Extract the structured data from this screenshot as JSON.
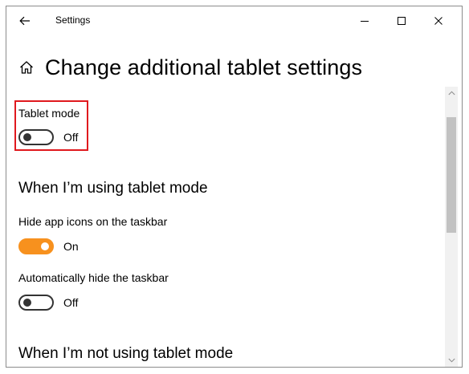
{
  "window": {
    "title": "Settings"
  },
  "page": {
    "title": "Change additional tablet settings"
  },
  "tablet_mode": {
    "label": "Tablet mode",
    "state_label": "Off",
    "is_on": false
  },
  "using_section": {
    "heading": "When I’m using tablet mode",
    "hide_icons": {
      "label": "Hide app icons on the taskbar",
      "state_label": "On",
      "is_on": true
    },
    "auto_hide": {
      "label": "Automatically hide the taskbar",
      "state_label": "Off",
      "is_on": false
    }
  },
  "not_using_section": {
    "heading": "When I’m not using tablet mode"
  },
  "icons": {
    "back": "back-arrow-icon",
    "minimize": "minimize-icon",
    "maximize": "maximize-icon",
    "close": "close-icon",
    "home": "home-icon",
    "scroll_up": "chevron-up-icon",
    "scroll_down": "chevron-down-icon"
  },
  "colors": {
    "toggle_on": "#f7911e",
    "toggle_off_border": "#333333",
    "highlight_box": "#e0191e"
  }
}
